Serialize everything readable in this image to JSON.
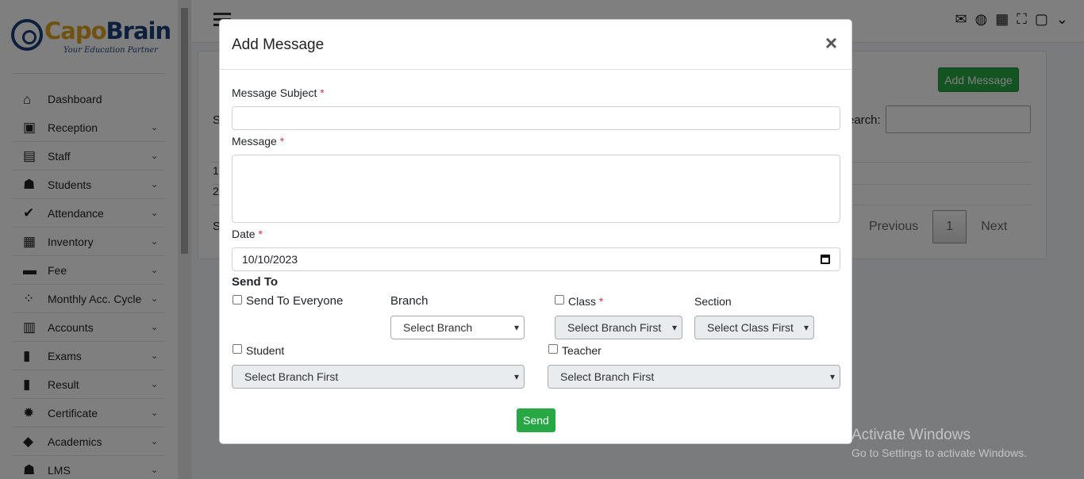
{
  "brand": {
    "name_part1": "Capo",
    "name_part2": "Brain",
    "tagline": "Your Education Partner"
  },
  "sidebar": {
    "items": [
      {
        "label": "Dashboard",
        "icon": "home-icon",
        "has_submenu": false
      },
      {
        "label": "Reception",
        "icon": "reception-icon",
        "has_submenu": true
      },
      {
        "label": "Staff",
        "icon": "staff-icon",
        "has_submenu": true
      },
      {
        "label": "Students",
        "icon": "students-icon",
        "has_submenu": true
      },
      {
        "label": "Attendance",
        "icon": "check-icon",
        "has_submenu": true
      },
      {
        "label": "Inventory",
        "icon": "clipboard-icon",
        "has_submenu": true
      },
      {
        "label": "Fee",
        "icon": "money-icon",
        "has_submenu": true
      },
      {
        "label": "Monthly Acc. Cycle",
        "icon": "spinner-icon",
        "has_submenu": true
      },
      {
        "label": "Accounts",
        "icon": "calculator-icon",
        "has_submenu": true
      },
      {
        "label": "Exams",
        "icon": "clipboard-icon",
        "has_submenu": true
      },
      {
        "label": "Result",
        "icon": "clipboard-icon",
        "has_submenu": true
      },
      {
        "label": "Certificate",
        "icon": "certificate-icon",
        "has_submenu": true
      },
      {
        "label": "Academics",
        "icon": "graduation-cap-icon",
        "has_submenu": true
      },
      {
        "label": "LMS",
        "icon": "teacher-icon",
        "has_submenu": true
      }
    ]
  },
  "background": {
    "add_message_label": "Add Message",
    "search_label": "earch:",
    "pagination": {
      "previous": "Previous",
      "page": "1",
      "next": "Next"
    },
    "partial_letters": {
      "s1": "S",
      "s2": "S",
      "s3": "S",
      "r1": "1",
      "r2": "2"
    }
  },
  "modal": {
    "title": "Add Message",
    "close": "×",
    "subject_label": "Message Subject",
    "message_label": "Message",
    "date_label": "Date",
    "date_value": "10/10/2023",
    "required_mark": "*",
    "send_to_title": "Send To",
    "everyone_label": "Send To Everyone",
    "branch_label": "Branch",
    "branch_select": "Select Branch",
    "class_label": "Class",
    "class_select": "Select Branch First",
    "section_label": "Section",
    "section_select": "Select Class First",
    "student_label": "Student",
    "student_select": "Select Branch First",
    "teacher_label": "Teacher",
    "teacher_select": "Select Branch First",
    "send_label": "Send"
  },
  "watermark": {
    "line1": "Activate Windows",
    "line2": "Go to Settings to activate Windows."
  },
  "colors": {
    "accent_green": "#28a745",
    "brand_blue": "#1c3f7a",
    "brand_gold": "#e0a321",
    "required_red": "#dc3545"
  }
}
